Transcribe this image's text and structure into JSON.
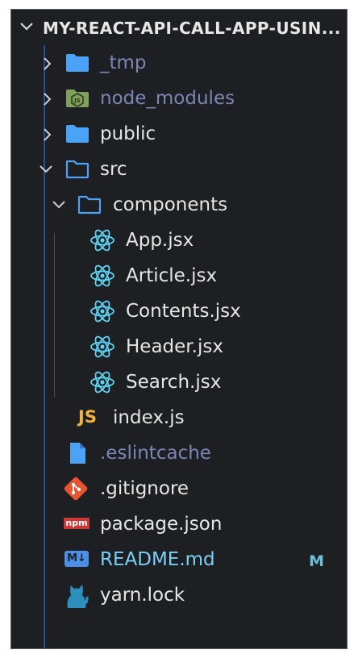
{
  "explorer": {
    "project_title": "MY-REACT-API-CALL-APP-USIN...",
    "items": [
      {
        "label": "_tmp",
        "kind": "folder",
        "state": "collapsed",
        "muted": true
      },
      {
        "label": "node_modules",
        "kind": "node-folder",
        "state": "collapsed",
        "muted": true
      },
      {
        "label": "public",
        "kind": "folder",
        "state": "collapsed",
        "muted": false
      },
      {
        "label": "src",
        "kind": "folder",
        "state": "expanded",
        "muted": false
      },
      {
        "label": "components",
        "kind": "folder",
        "state": "expanded",
        "muted": false
      },
      {
        "label": "App.jsx",
        "kind": "react-file"
      },
      {
        "label": "Article.jsx",
        "kind": "react-file"
      },
      {
        "label": "Contents.jsx",
        "kind": "react-file"
      },
      {
        "label": "Header.jsx",
        "kind": "react-file"
      },
      {
        "label": "Search.jsx",
        "kind": "react-file"
      },
      {
        "label": "index.js",
        "kind": "js-file",
        "icon_text": "JS"
      },
      {
        "label": ".eslintcache",
        "kind": "file",
        "muted": true
      },
      {
        "label": ".gitignore",
        "kind": "git-file"
      },
      {
        "label": "package.json",
        "kind": "npm-file",
        "icon_text": "npm"
      },
      {
        "label": "README.md",
        "kind": "markdown-file",
        "icon_text": "M↓",
        "status": "M"
      },
      {
        "label": "yarn.lock",
        "kind": "yarn-file"
      }
    ]
  },
  "colors": {
    "background": "#1e1f22",
    "text": "#e6e6e6",
    "muted_text": "#7c86b5",
    "modified_text": "#79d0f5",
    "folder_blue": "#4aa3f7",
    "react_cyan": "#5ed3f3",
    "js_yellow": "#f0b33a",
    "git_orange": "#e8542f",
    "npm_red": "#cb3837",
    "md_blue": "#4d8fe6",
    "yarn_blue": "#2c8ebb"
  }
}
